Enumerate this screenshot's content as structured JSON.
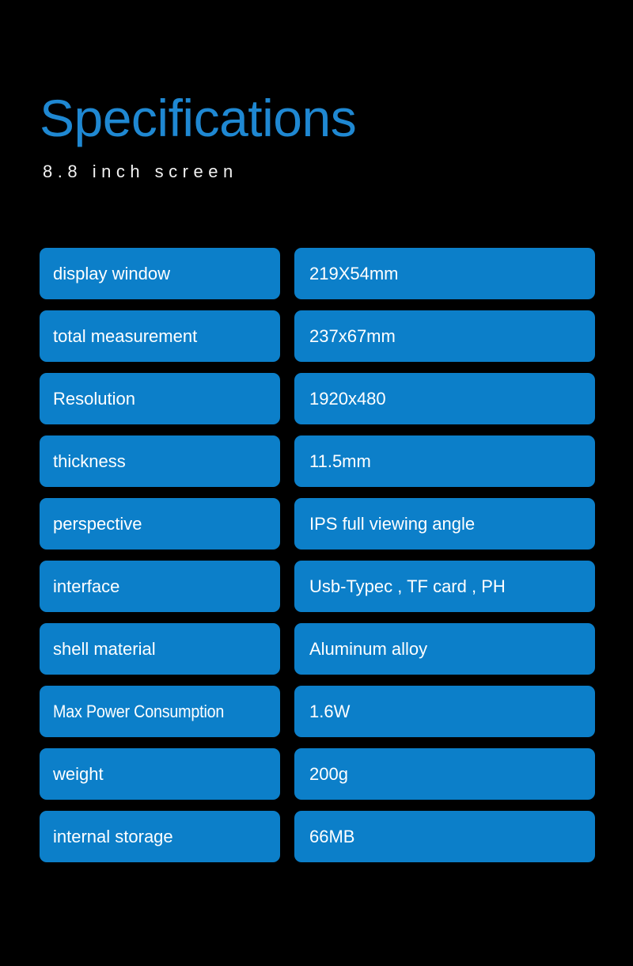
{
  "theme": {
    "background": "#000000",
    "title_color": "#1f88d2",
    "subtitle_color": "#f2f2f2",
    "pill_color": "#0c7fc9",
    "pill_text_color": "#ffffff"
  },
  "header": {
    "title": "Specifications",
    "subtitle": "8.8 inch screen"
  },
  "spec_table": {
    "rows": [
      {
        "label": "display window",
        "value": "219X54mm"
      },
      {
        "label": "total measurement",
        "value": "237x67mm"
      },
      {
        "label": "Resolution",
        "value": "1920x480"
      },
      {
        "label": "thickness",
        "value": "11.5mm"
      },
      {
        "label": "perspective",
        "value": "IPS full viewing angle"
      },
      {
        "label": "interface",
        "value": "Usb-Typec , TF card , PH"
      },
      {
        "label": "shell material",
        "value": "Aluminum alloy"
      },
      {
        "label": "Max Power Consumption",
        "value": "1.6W"
      },
      {
        "label": "weight",
        "value": "200g"
      },
      {
        "label": "internal storage",
        "value": "66MB"
      }
    ]
  }
}
